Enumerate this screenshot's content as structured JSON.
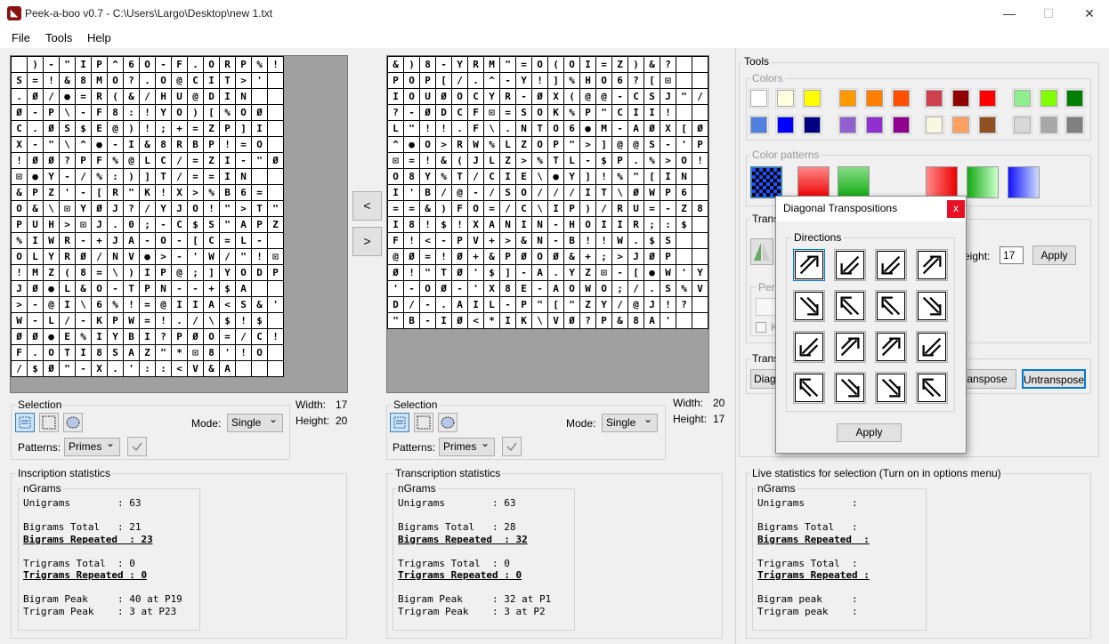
{
  "window": {
    "title": "Peek-a-boo v0.7 - C:\\Users\\Largo\\Desktop\\new 1.txt",
    "minimize": "—",
    "maximize": "☐",
    "close": "✕",
    "icon": "app-icon"
  },
  "menu": [
    "File",
    "Tools",
    "Help"
  ],
  "left": {
    "rows": [
      " )-\"IP^6O-F.ORP%!",
      "S=!&8MO?.O@CIT>'",
      ".Ø/●=R(&/HU@DIN",
      "Ø-P\\-F8:!YO)[%OØ",
      "C.ØS$E@)!;+=ZP]I",
      "X-\"\\^●-I&8RBP!=O",
      "!ØØ?PF%@LC/=ZI-\"Ø",
      "⊡●Y-/%:)]T/==IN",
      "&PZ'-[R\"K!X>%B6=",
      "O&\\⊡YØJ?/YJO!\">T\"",
      "PUH>⊡J.0;-C$S\"APZ",
      "%IWR-+JA-O-[C=L-",
      "OLYRØ/NV●>-'W/\"!⊡",
      "!MZ(8=\\)IP@;]YODP",
      "JØ●L&O-TPN--+$A",
      ">-@I\\6%!=@IIA<S&'",
      "W-L/-KPW=!./\\$!$",
      "ØØ●E%IYBI?PØO=/C!",
      "F.OTI8SAZ\"*⊡8'!O",
      "/$Ø\"-X.'::<V&A"
    ],
    "width_label": "Width:",
    "width": "17",
    "height_label": "Height:",
    "height": "20",
    "selection_label": "Selection",
    "mode_label": "Mode:",
    "mode": "Single",
    "patterns_label": "Patterns:",
    "pattern": "Primes",
    "stats_title": "Inscription statistics",
    "stats": {
      "group": "nGrams",
      "lines": [
        "Unigrams        : 63",
        "",
        "Bigrams Total   : 21",
        "Bigrams Repeated  : 23",
        "",
        "Trigrams Total  : 0",
        "Trigrams Repeated : 0",
        "",
        "Bigram Peak     : 40 at P19",
        "Trigram Peak    : 3 at P23"
      ]
    }
  },
  "right": {
    "rows": [
      "&)8-YRM\"=O(OI=Z)&?",
      "POP[/.^-Y!]%HO6?[⊡",
      "IOUØOCYR-ØX(@@-CSJ\"/",
      "?-ØDCF⊡=SOK%P\"CII!",
      "L\"!!.F\\.NTO6●M-AØX[Ø",
      "^●O>RW%LZOP\">]@@S-'P",
      "⊡=!&(JLZ>%TL-$P.%>O!",
      "O8Y%T/CIE\\●Y]!%\"[IN",
      "I'B/@-/SO///IT\\ØWP6",
      "==&)FO=/C\\IP)/RU=-Z8",
      "I8!$!XANIN-HOIIR;:$",
      "F!<-PV+>&N-B!!W.$S",
      "@Ø=!Ø+&PØOØ&+;>JØP",
      "Ø!\"TØ'$]-A.YZ⊡-[●W'Y",
      "'-OØ-'X8E-AOWO;/.S%V>",
      "D/-.AIL-P\"[\"ZY/@J!?",
      "\"B-IØ<*IK\\VØ?P&8A'"
    ],
    "width_label": "Width:",
    "width": "20",
    "height_label": "Height:",
    "height": "17",
    "selection_label": "Selection",
    "mode_label": "Mode:",
    "mode": "Single",
    "patterns_label": "Patterns:",
    "pattern": "Primes",
    "stats_title": "Transcription statistics",
    "stats": {
      "group": "nGrams",
      "lines": [
        "Unigrams        : 63",
        "",
        "Bigrams Total   : 28",
        "Bigrams Repeated  : 32",
        "",
        "Trigrams Total  : 0",
        "Trigrams Repeated : 0",
        "",
        "Bigram Peak     : 32 at P1",
        "Trigram Peak    : 3 at P2"
      ]
    }
  },
  "move_left": "<",
  "move_right": ">",
  "tools": {
    "title": "Tools",
    "colors_label": "Colors",
    "colors_row1": [
      "#ffffff",
      "#ffffe0",
      "#ffff00",
      "#ff9900",
      "#ff8000",
      "#ff5000",
      "#d04050",
      "#900000",
      "#ff0000",
      "#90ee90",
      "#80ff00",
      "#008000"
    ],
    "colors_row2": [
      "#5080e0",
      "#0000ff",
      "#000080",
      "#9060d0",
      "#9030d0",
      "#900090",
      "#f8f8e0",
      "#ffa060",
      "#905020",
      "#d8d8d8",
      "#a8a8a8",
      "#808080"
    ],
    "patterns_label": "Color patterns",
    "trans_label": "Trans",
    "height_label": "eight:",
    "height": "17",
    "apply": "Apply",
    "peri_label": "Peri",
    "k_label": "K",
    "trans2_label": "Trans",
    "diag_button": "Diago",
    "transpose": "anspose",
    "untranspose": "Untranspose"
  },
  "live": {
    "title": "Live statistics for selection (Turn on in options menu)",
    "group": "nGrams",
    "lines": [
      "Unigrams        :",
      "",
      "Bigrams Total   :",
      "Bigrams Repeated  :",
      "",
      "Trigrams Total  :",
      "Trigrams Repeated :",
      "",
      "Bigram peak     :",
      "Trigram peak    :"
    ]
  },
  "dialog": {
    "title": "Diagonal Transpositions",
    "close": "x",
    "group": "Directions",
    "apply": "Apply",
    "arrows": [
      "arrows-ne-icon",
      "arrows-sw-icon",
      "arrows-sw-icon",
      "arrows-ne-icon",
      "arrows-se-icon",
      "arrows-nw-icon",
      "arrows-nw-icon",
      "arrows-se-icon",
      "arrows-sw-icon",
      "arrows-ne-icon",
      "arrows-ne-icon",
      "arrows-sw-icon",
      "arrows-nw-icon",
      "arrows-se-icon",
      "arrows-se-icon",
      "arrows-nw-icon"
    ]
  }
}
